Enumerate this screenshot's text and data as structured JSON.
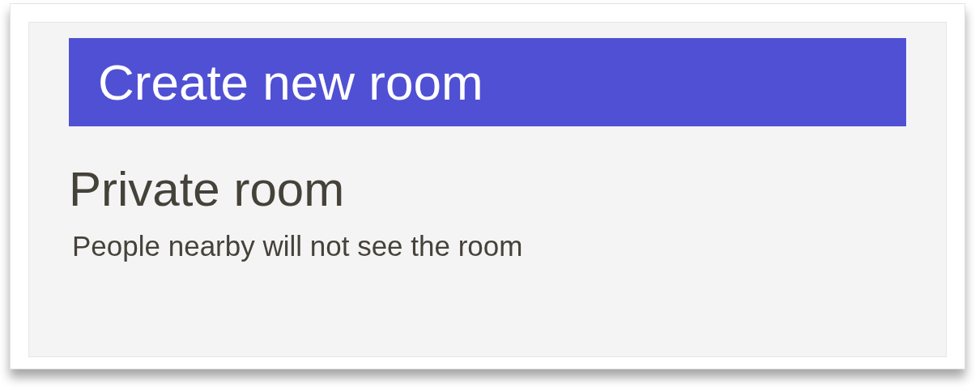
{
  "header": {
    "title": "Create new room"
  },
  "option": {
    "title": "Private room",
    "description": "People nearby will not see the room"
  }
}
